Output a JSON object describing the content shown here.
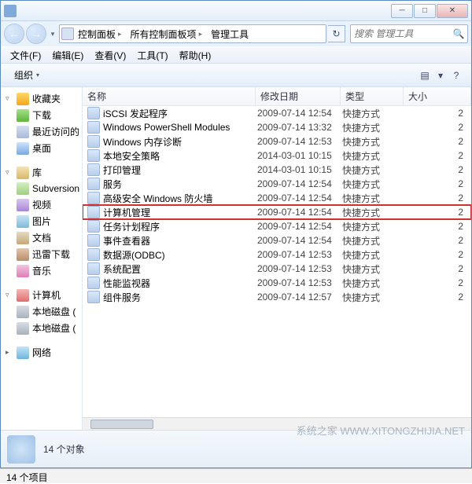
{
  "window": {
    "title_hidden": "管理工具",
    "min": "─",
    "max": "□",
    "close": "✕"
  },
  "nav": {
    "back": "←",
    "fwd": "→"
  },
  "breadcrumb": {
    "seg1": "控制面板",
    "seg2": "所有控制面板项",
    "seg3": "管理工具",
    "sep": "▸"
  },
  "search": {
    "placeholder": "搜索 管理工具"
  },
  "menu": {
    "file": "文件(F)",
    "edit": "编辑(E)",
    "view": "查看(V)",
    "tools": "工具(T)",
    "help": "帮助(H)"
  },
  "toolbar": {
    "organize": "组织",
    "arr": "▾",
    "view_icon": "▤",
    "view_arr": "▾",
    "help": "?"
  },
  "sidebar": {
    "fav": {
      "label": "收藏夹"
    },
    "dl": {
      "label": "下载"
    },
    "recent": {
      "label": "最近访问的"
    },
    "desktop": {
      "label": "桌面"
    },
    "lib": {
      "label": "库"
    },
    "sub": {
      "label": "Subversion"
    },
    "video": {
      "label": "视频"
    },
    "pic": {
      "label": "图片"
    },
    "doc": {
      "label": "文档"
    },
    "xl": {
      "label": "迅雷下载"
    },
    "music": {
      "label": "音乐"
    },
    "computer": {
      "label": "计算机"
    },
    "disk1": {
      "label": "本地磁盘 ("
    },
    "disk2": {
      "label": "本地磁盘 ("
    },
    "network": {
      "label": "网络"
    }
  },
  "columns": {
    "name": "名称",
    "date": "修改日期",
    "type": "类型",
    "size": "大小"
  },
  "rows": [
    {
      "name": "iSCSI 发起程序",
      "date": "2009-07-14 12:54",
      "type": "快捷方式",
      "size": "2"
    },
    {
      "name": "Windows PowerShell Modules",
      "date": "2009-07-14 13:32",
      "type": "快捷方式",
      "size": "2"
    },
    {
      "name": "Windows 内存诊断",
      "date": "2009-07-14 12:53",
      "type": "快捷方式",
      "size": "2"
    },
    {
      "name": "本地安全策略",
      "date": "2014-03-01 10:15",
      "type": "快捷方式",
      "size": "2"
    },
    {
      "name": "打印管理",
      "date": "2014-03-01 10:15",
      "type": "快捷方式",
      "size": "2"
    },
    {
      "name": "服务",
      "date": "2009-07-14 12:54",
      "type": "快捷方式",
      "size": "2"
    },
    {
      "name": "高级安全 Windows 防火墙",
      "date": "2009-07-14 12:54",
      "type": "快捷方式",
      "size": "2"
    },
    {
      "name": "计算机管理",
      "date": "2009-07-14 12:54",
      "type": "快捷方式",
      "size": "2",
      "hl": true
    },
    {
      "name": "任务计划程序",
      "date": "2009-07-14 12:54",
      "type": "快捷方式",
      "size": "2"
    },
    {
      "name": "事件查看器",
      "date": "2009-07-14 12:54",
      "type": "快捷方式",
      "size": "2"
    },
    {
      "name": "数据源(ODBC)",
      "date": "2009-07-14 12:53",
      "type": "快捷方式",
      "size": "2"
    },
    {
      "name": "系统配置",
      "date": "2009-07-14 12:53",
      "type": "快捷方式",
      "size": "2"
    },
    {
      "name": "性能监视器",
      "date": "2009-07-14 12:53",
      "type": "快捷方式",
      "size": "2"
    },
    {
      "name": "组件服务",
      "date": "2009-07-14 12:57",
      "type": "快捷方式",
      "size": "2"
    }
  ],
  "details": {
    "text": "14 个对象"
  },
  "status": {
    "text": "14 个项目"
  },
  "watermark": "系统之家  WWW.XITONGZHIJIA.NET"
}
